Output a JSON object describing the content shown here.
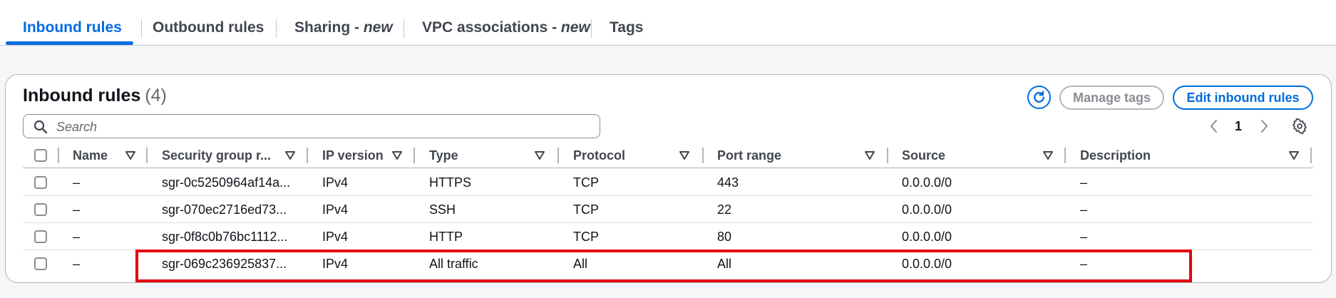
{
  "tabs": [
    {
      "label": "Inbound rules",
      "suffix": ""
    },
    {
      "label": "Outbound rules",
      "suffix": ""
    },
    {
      "label": "Sharing - ",
      "suffix": "new"
    },
    {
      "label": "VPC associations - ",
      "suffix": "new"
    },
    {
      "label": "Tags",
      "suffix": ""
    }
  ],
  "active_tab": "Inbound rules",
  "header": {
    "title": "Inbound rules",
    "count": "(4)"
  },
  "buttons": {
    "refresh_icon": "refresh-icon",
    "manage_tags": "Manage tags",
    "edit_inbound": "Edit inbound rules"
  },
  "search": {
    "placeholder": "Search",
    "value": ""
  },
  "pagination": {
    "current_page": "1"
  },
  "columns": [
    "Name",
    "Security group r...",
    "IP version",
    "Type",
    "Protocol",
    "Port range",
    "Source",
    "Description"
  ],
  "rows": [
    {
      "name": "–",
      "sgr": "sgr-0c5250964af14a...",
      "ip": "IPv4",
      "type": "HTTPS",
      "protocol": "TCP",
      "port": "443",
      "source": "0.0.0.0/0",
      "description": "–"
    },
    {
      "name": "–",
      "sgr": "sgr-070ec2716ed73...",
      "ip": "IPv4",
      "type": "SSH",
      "protocol": "TCP",
      "port": "22",
      "source": "0.0.0.0/0",
      "description": "–"
    },
    {
      "name": "–",
      "sgr": "sgr-0f8c0b76bc1112...",
      "ip": "IPv4",
      "type": "HTTP",
      "protocol": "TCP",
      "port": "80",
      "source": "0.0.0.0/0",
      "description": "–"
    },
    {
      "name": "–",
      "sgr": "sgr-069c236925837...",
      "ip": "IPv4",
      "type": "All traffic",
      "protocol": "All",
      "port": "All",
      "source": "0.0.0.0/0",
      "description": "–"
    }
  ],
  "colors": {
    "accent": "#006ce0",
    "highlight": "#e3000f",
    "text": "#0f141a"
  }
}
